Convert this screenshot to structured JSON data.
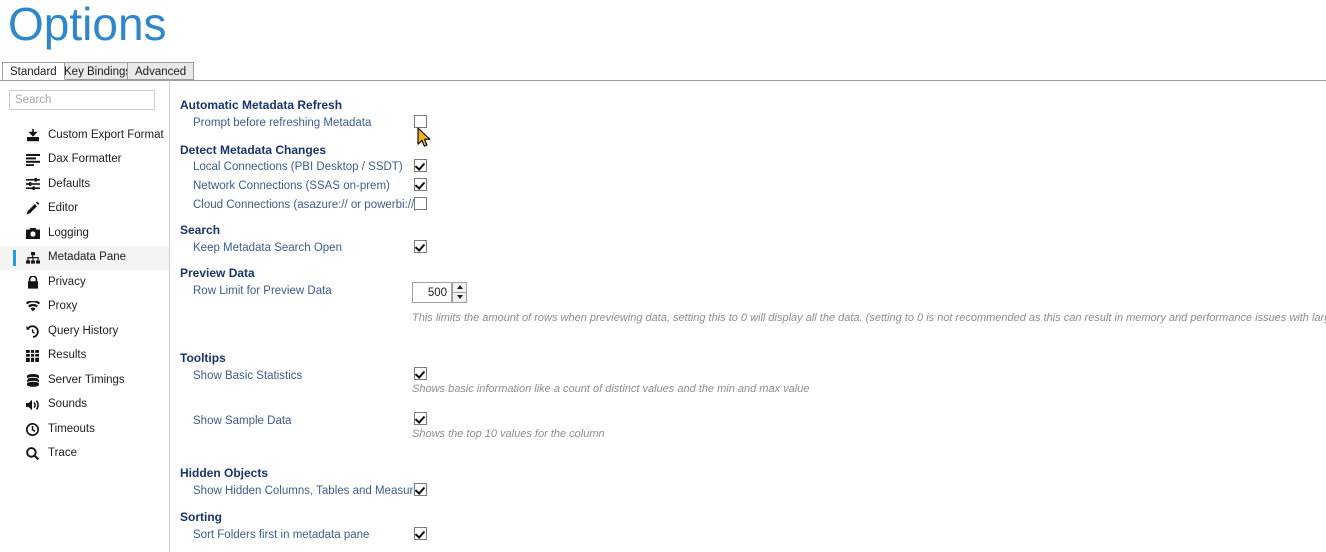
{
  "page_title": "Options",
  "accent_colors": {
    "title_blue": "#2f87cb",
    "group_head_navy": "#17356b",
    "label_blue": "#3d5d8b",
    "selection_bar": "#1ba1e2",
    "help_gray": "#8d8d8d"
  },
  "tabs": [
    {
      "label": "Standard",
      "active": true
    },
    {
      "label": "Key Bindings",
      "active": false
    },
    {
      "label": "Advanced",
      "active": false
    }
  ],
  "sidebar": {
    "search": {
      "value": "",
      "placeholder": "Search"
    },
    "items": [
      {
        "label": "Custom Export Format",
        "icon": "export-icon",
        "selected": false
      },
      {
        "label": "Dax Formatter",
        "icon": "align-lines-icon",
        "selected": false
      },
      {
        "label": "Defaults",
        "icon": "sliders-icon",
        "selected": false
      },
      {
        "label": "Editor",
        "icon": "pencil-icon",
        "selected": false
      },
      {
        "label": "Logging",
        "icon": "camera-icon",
        "selected": false
      },
      {
        "label": "Metadata Pane",
        "icon": "hierarchy-icon",
        "selected": true
      },
      {
        "label": "Privacy",
        "icon": "lock-icon",
        "selected": false
      },
      {
        "label": "Proxy",
        "icon": "wifi-icon",
        "selected": false
      },
      {
        "label": "Query History",
        "icon": "history-icon",
        "selected": false
      },
      {
        "label": "Results",
        "icon": "grid-icon",
        "selected": false
      },
      {
        "label": "Server Timings",
        "icon": "database-icon",
        "selected": false
      },
      {
        "label": "Sounds",
        "icon": "speaker-icon",
        "selected": false
      },
      {
        "label": "Timeouts",
        "icon": "clock-icon",
        "selected": false
      },
      {
        "label": "Trace",
        "icon": "search-icon",
        "selected": false
      }
    ]
  },
  "content": {
    "groups": {
      "automatic_metadata_refresh": "Automatic Metadata Refresh",
      "detect_metadata_changes": "Detect Metadata Changes",
      "search": "Search",
      "preview_data": "Preview Data",
      "tooltips": "Tooltips",
      "hidden_objects": "Hidden Objects",
      "sorting": "Sorting"
    },
    "options": {
      "prompt_before_refresh": {
        "label": "Prompt before refreshing Metadata",
        "checked": false
      },
      "local_connections": {
        "label": "Local Connections (PBI Desktop / SSDT)",
        "checked": true
      },
      "network_connections": {
        "label": "Network Connections (SSAS on-prem)",
        "checked": true
      },
      "cloud_connections": {
        "label": "Cloud Connections (asazure:// or powerbi://)",
        "checked": false
      },
      "keep_metadata_search_open": {
        "label": "Keep Metadata Search Open",
        "checked": true
      },
      "row_limit": {
        "label": "Row Limit for Preview Data",
        "value": "500",
        "help": "This limits the amount of rows when previewing data, setting this to 0 will display all the data. (setting to 0 is not recommended as this can result in memory and performance issues with large tables)"
      },
      "show_basic_statistics": {
        "label": "Show Basic Statistics",
        "checked": true,
        "help": "Shows basic information like a count of distinct values and the min and max value"
      },
      "show_sample_data": {
        "label": "Show Sample Data",
        "checked": true,
        "help": "Shows the top 10 values for the column"
      },
      "show_hidden": {
        "label": "Show Hidden Columns, Tables and Measures",
        "checked": true
      },
      "sort_folders_first": {
        "label": "Sort Folders first in metadata pane",
        "checked": true
      }
    }
  }
}
